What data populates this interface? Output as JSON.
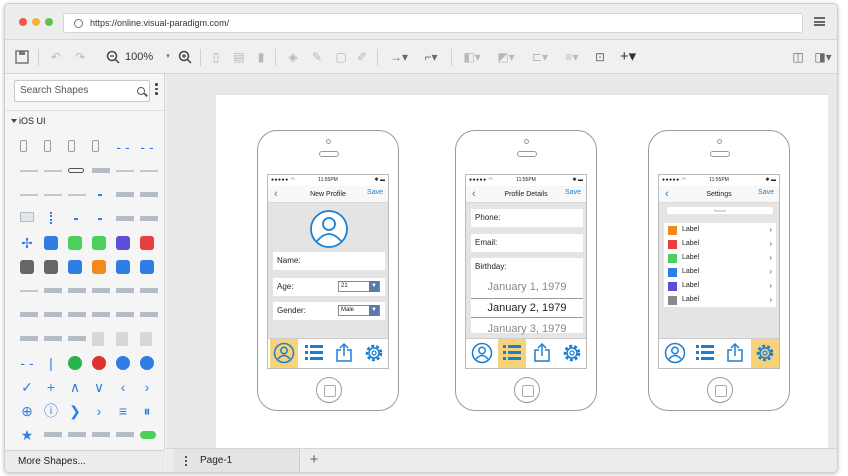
{
  "browser": {
    "url": "https://online.visual-paradigm.com/",
    "dot_colors": [
      "#ee5a4f",
      "#f4b23c",
      "#5cc24a"
    ]
  },
  "toolbar": {
    "zoom_level": "100%",
    "icons": [
      "save-icon",
      "undo-icon",
      "redo-icon",
      "zoom-out-icon",
      "zoom-in-icon",
      "copy-icon",
      "paste-icon",
      "delete-icon",
      "fill-icon",
      "line-color-icon",
      "shadow-icon",
      "format-painter-icon",
      "connector-icon",
      "waypoint-icon",
      "arrange-icon",
      "group-icon",
      "align-icon",
      "distribute-icon",
      "select-icon",
      "add-icon",
      "outline-icon",
      "panel-icon"
    ]
  },
  "sidebar": {
    "search_placeholder": "Search Shapes",
    "section_title": "iOS UI",
    "more_shapes": "More Shapes..."
  },
  "pages": {
    "tabs": [
      {
        "label": "Page-1"
      }
    ]
  },
  "phones": [
    {
      "status_time": "11:55PM",
      "nav_title": "New Profile",
      "nav_save": "Save",
      "fields": [
        {
          "label": "Name:"
        },
        {
          "label": "Age:",
          "value": "21"
        },
        {
          "label": "Gender:",
          "value": "Male"
        }
      ],
      "active_tab": 0
    },
    {
      "status_time": "11:55PM",
      "nav_title": "Profile Details",
      "nav_save": "Save",
      "fields": [
        {
          "label": "Phone:"
        },
        {
          "label": "Email:"
        },
        {
          "label": "Birthday:"
        }
      ],
      "picker": [
        "January 1, 1979",
        "January 2, 1979",
        "January 3, 1979"
      ],
      "active_tab": 1
    },
    {
      "status_time": "11:55PM",
      "nav_title": "Settings",
      "nav_save": "Save",
      "search_placeholder": "Search",
      "rows": [
        {
          "label": "Label",
          "color": "#f28a1e"
        },
        {
          "label": "Label",
          "color": "#e84040"
        },
        {
          "label": "Label",
          "color": "#4ccf5c"
        },
        {
          "label": "Label",
          "color": "#2e7ee6"
        },
        {
          "label": "Label",
          "color": "#5a4fd6"
        },
        {
          "label": "Label",
          "color": "#8a8a8a"
        }
      ],
      "active_tab": 3
    }
  ]
}
